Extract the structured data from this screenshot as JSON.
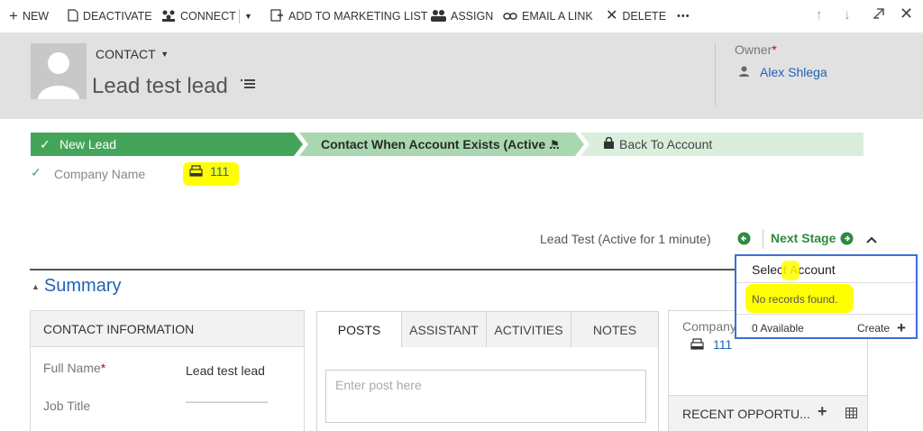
{
  "commands": {
    "new": "NEW",
    "deactivate": "DEACTIVATE",
    "connect": "CONNECT",
    "add_to_marketing_list": "ADD TO MARKETING LIST",
    "assign": "ASSIGN",
    "email_a_link": "EMAIL A LINK",
    "delete": "DELETE",
    "more": "•••"
  },
  "header": {
    "entity_label": "CONTACT",
    "record_title": "Lead test lead",
    "owner_label": "Owner",
    "required_mark": "*",
    "owner_name": "Alex Shlega"
  },
  "process": {
    "stages": [
      "New Lead",
      "Contact When Account Exists (Active ...",
      "Back To Account"
    ],
    "field_label": "Company Name",
    "field_value": "111",
    "status": "Lead Test (Active for 1 minute)",
    "next_stage": "Next Stage"
  },
  "summary": {
    "title": "Summary",
    "contact_info_title": "CONTACT INFORMATION",
    "full_name_label": "Full Name",
    "full_name_value": "Lead test lead",
    "job_title_label": "Job Title",
    "job_title_value": "--------------------------------"
  },
  "tabs": [
    "POSTS",
    "ASSISTANT",
    "ACTIVITIES",
    "NOTES"
  ],
  "post_placeholder": "Enter post here",
  "right_card": {
    "company_label": "Company",
    "company_value": "111",
    "recent_opportunities": "RECENT OPPORTU..."
  },
  "lookup_dropdown": {
    "title": "Select Account",
    "message": "No records found.",
    "available": "0 Available",
    "create": "Create"
  },
  "colors": {
    "active_stage": "#44a55a",
    "next_stage_bg": "#a9d7b0",
    "future_stage_bg": "#daeedd",
    "link_blue": "#1f63b5",
    "highlight": "#ffff00",
    "dropdown_border": "#3b6fd6"
  }
}
